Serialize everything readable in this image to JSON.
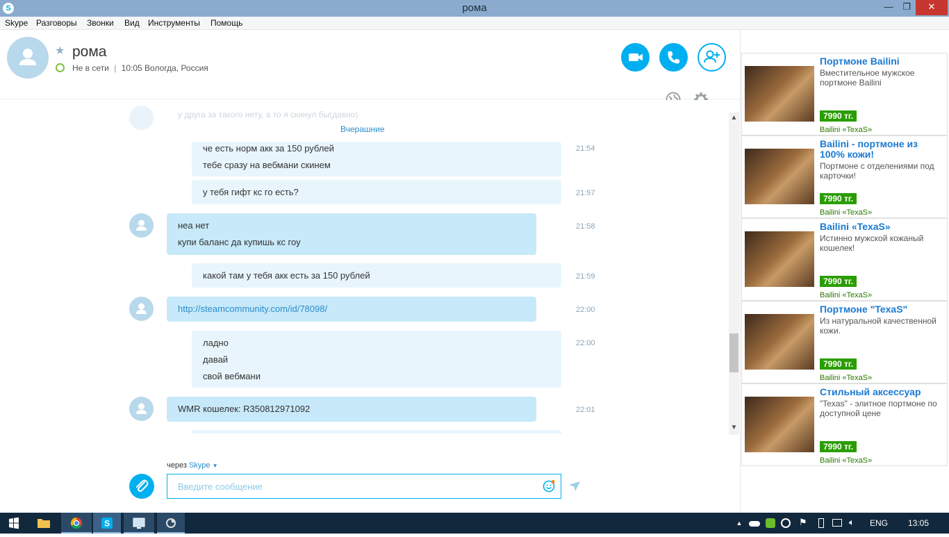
{
  "window": {
    "title": "рома"
  },
  "menu": [
    "Skype",
    "Разговоры",
    "Звонки",
    "Вид",
    "Инструменты",
    "Помощь"
  ],
  "contact": {
    "name": "рома",
    "status": "Не в сети",
    "separator": "|",
    "local_time": "10:05 Вологда, Россия"
  },
  "chat": {
    "ghost_text": "у друга за такого нету, а то я скинул бы(давно)",
    "divider": "Вчерашние",
    "messages": [
      {
        "from": "me",
        "lines": [
          "че есть норм акк за 150 рублей",
          "тебе сразу на вебмани скинем"
        ],
        "time": "21:54"
      },
      {
        "from": "me",
        "lines": [
          "у тебя гифт кс го есть?"
        ],
        "time": "21:57"
      },
      {
        "from": "them",
        "lines": [
          "неа нет",
          "купи баланс да купишь кс гоу"
        ],
        "time": "21:58"
      },
      {
        "from": "me",
        "lines": [
          "какой там у тебя акк есть за 150 рублей"
        ],
        "time": "21:59"
      },
      {
        "from": "them",
        "lines": [
          "http://steamcommunity.com/id/78098/"
        ],
        "time": "22:00"
      },
      {
        "from": "me",
        "lines": [
          "ладно",
          "давай",
          "свой вебмани"
        ],
        "time": "22:00"
      },
      {
        "from": "them",
        "lines": [
          "WMR кошелек: R350812971092"
        ],
        "time": "22:01"
      }
    ]
  },
  "compose": {
    "via_label": "через",
    "via_service": "Skype",
    "placeholder": "Введите сообщение"
  },
  "ads": [
    {
      "title": "Портмоне Bailini",
      "desc": "Вместительное мужское портмоне Bailini",
      "price": "7990 тг.",
      "shop": "Bailini «TexaS»"
    },
    {
      "title": "Bailini - портмоне из 100% кожи!",
      "desc": "Портмоне с отделениями под карточки!",
      "price": "7990 тг.",
      "shop": "Bailini «TexaS»"
    },
    {
      "title": "Bailini «TexaS»",
      "desc": "Истинно мужской кожаный кошелек!",
      "price": "7990 тг.",
      "shop": "Bailini «TexaS»"
    },
    {
      "title": "Портмоне \"TexaS\"",
      "desc": "Из натуральной качественной кожи.",
      "price": "7990 тг.",
      "shop": "Bailini «TexaS»"
    },
    {
      "title": "Стильный аксессуар",
      "desc": "\"Texas\" - элитное портмоне по доступной цене",
      "price": "7990 тг.",
      "shop": "Bailini «TexaS»"
    }
  ],
  "taskbar": {
    "language": "ENG",
    "clock": "13:05"
  },
  "colors": {
    "accent": "#00aff0",
    "bubble_mine": "#e8f5fc",
    "bubble_theirs": "#c7e9f9",
    "ad_price": "#2a9d00"
  }
}
